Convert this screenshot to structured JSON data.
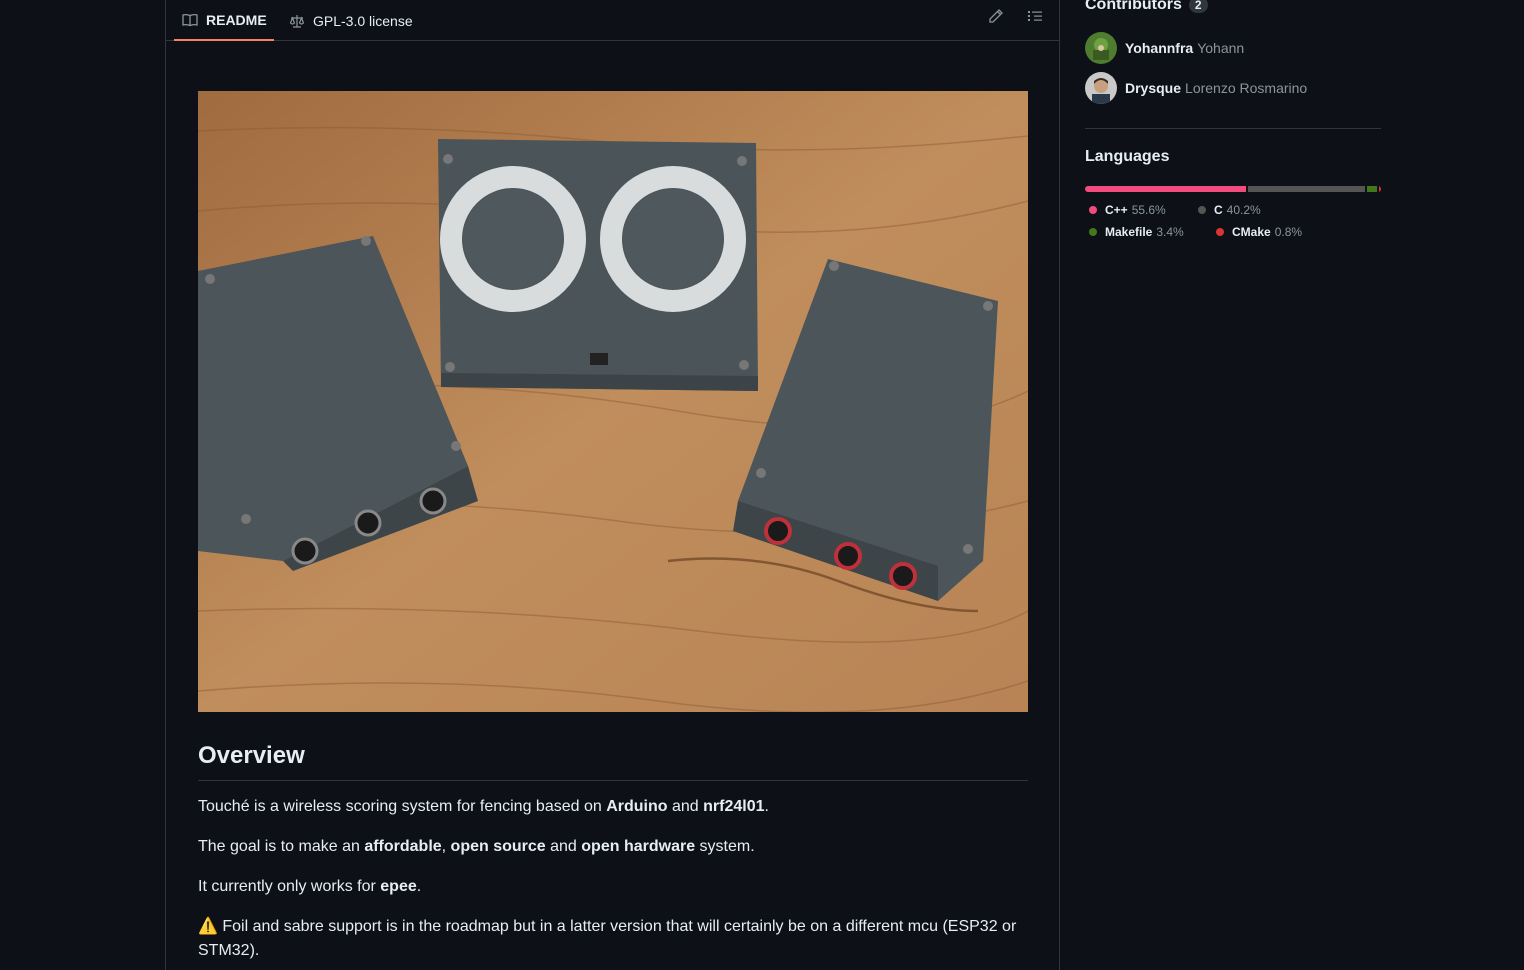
{
  "readme_tabs": {
    "readme_label": "README",
    "license_label": "GPL-3.0 license"
  },
  "readme": {
    "overview_heading": "Overview",
    "p1": {
      "a": "Touché is a wireless scoring system for fencing based on ",
      "b": "Arduino",
      "c": " and ",
      "d": "nrf24l01",
      "e": "."
    },
    "p2": {
      "a": "The goal is to make an ",
      "b": "affordable",
      "c": ", ",
      "d": "open source",
      "e": " and ",
      "f": "open hardware",
      "g": " system."
    },
    "p3": {
      "a": "It currently only works for ",
      "b": "epee",
      "c": "."
    },
    "p4": {
      "emoji": "⚠️",
      "text": " Foil and sabre support is in the roadmap but in a latter version that will certainly be on a different mcu (ESP32 or STM32)."
    }
  },
  "contributors": {
    "title": "Contributors",
    "count": "2",
    "items": [
      {
        "login": "Yohannfra",
        "name": "Yohann"
      },
      {
        "login": "Drysque",
        "name": "Lorenzo Rosmarino"
      }
    ]
  },
  "languages": {
    "title": "Languages",
    "items": [
      {
        "name": "C++",
        "percent": "55.6%",
        "value": 55.6,
        "color": "#f34b7d"
      },
      {
        "name": "C",
        "percent": "40.2%",
        "value": 40.2,
        "color": "#555555"
      },
      {
        "name": "Makefile",
        "percent": "3.4%",
        "value": 3.4,
        "color": "#427819"
      },
      {
        "name": "CMake",
        "percent": "0.8%",
        "value": 0.8,
        "color": "#da3434"
      }
    ]
  }
}
